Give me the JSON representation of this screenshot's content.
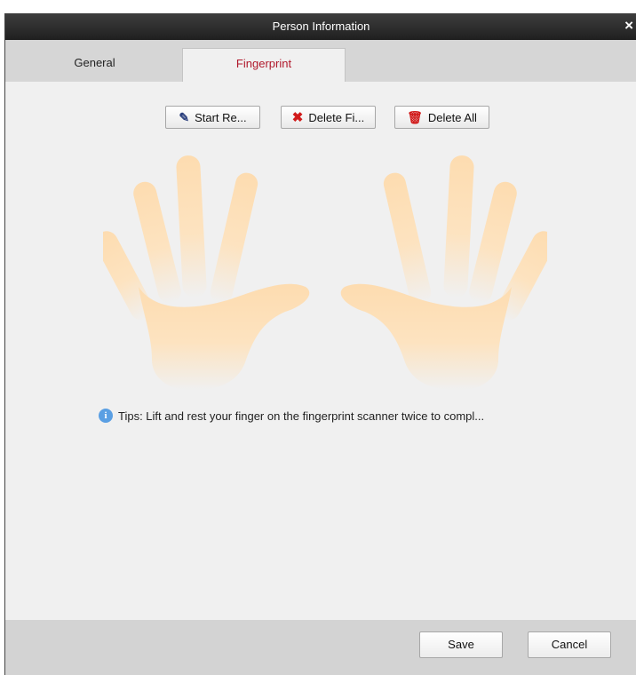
{
  "window": {
    "title": "Person Information"
  },
  "tabs": [
    {
      "label": "General",
      "active": false
    },
    {
      "label": "Fingerprint",
      "active": true
    }
  ],
  "toolbar": {
    "start_label": "Start Re...",
    "delete_label": "Delete Fi...",
    "delete_all_label": "Delete All"
  },
  "tip": {
    "text": "Tips: Lift and rest your finger on the fingerprint scanner twice to compl..."
  },
  "footer": {
    "save_label": "Save",
    "cancel_label": "Cancel"
  },
  "icons": {
    "close": "close-icon",
    "start": "pencil-icon",
    "delete": "red-x-icon",
    "delete_all": "trash-icon",
    "tip": "info-icon"
  },
  "colors": {
    "active_tab_text": "#b0192c",
    "hand": "#fde1b8",
    "titlebar": "#2a2a2a",
    "footer": "#d3d3d3",
    "content_bg": "#f0f0f0",
    "info": "#5a9fe3"
  }
}
